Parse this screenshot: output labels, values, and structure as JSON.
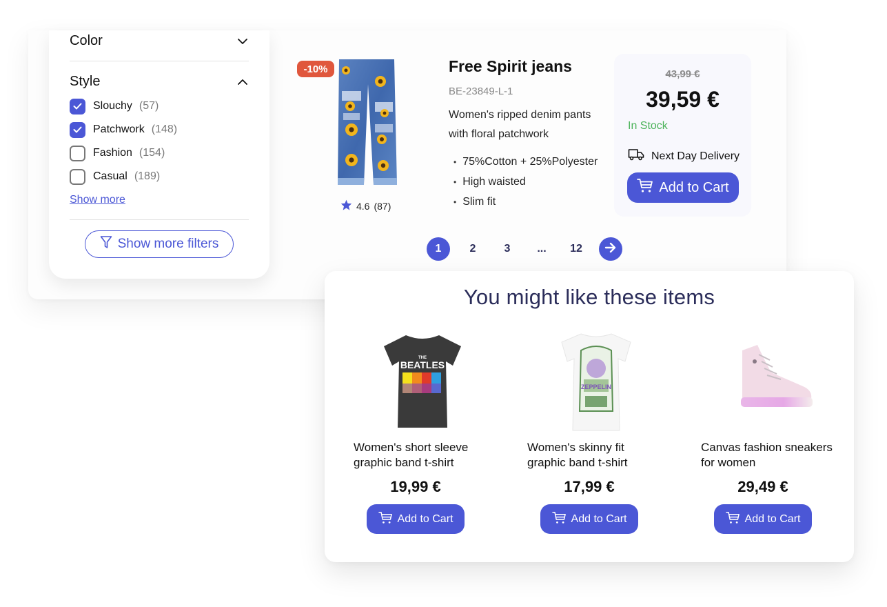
{
  "filters": {
    "color": {
      "label": "Color",
      "expanded": false
    },
    "style": {
      "label": "Style",
      "expanded": true,
      "options": [
        {
          "label": "Slouchy",
          "count": "(57)",
          "checked": true
        },
        {
          "label": "Patchwork",
          "count": "(148)",
          "checked": true
        },
        {
          "label": "Fashion",
          "count": "(154)",
          "checked": false
        },
        {
          "label": "Casual",
          "count": "(189)",
          "checked": false
        }
      ],
      "show_more": "Show more"
    },
    "more_filters_label": "Show more filters"
  },
  "product": {
    "badge": "-10%",
    "image": "jeans-with-sunflower-patches",
    "rating": "4.6",
    "reviews": "(87)",
    "title": "Free Spirit jeans",
    "sku": "BE-23849-L-1",
    "description": "Women's ripped denim pants with floral patchwork",
    "features": [
      "75%Cotton + 25%Polyester",
      "High waisted",
      "Slim fit"
    ],
    "old_price": "43,99 €",
    "price": "39,59 €",
    "stock": "In Stock",
    "delivery": "Next Day Delivery",
    "cart_label": "Add to Cart"
  },
  "pagination": {
    "pages": [
      "1",
      "2",
      "3",
      "...",
      "12"
    ],
    "current": "1",
    "next_icon": "arrow-right-icon"
  },
  "recommendations": {
    "title": "You might like these items",
    "items": [
      {
        "name": "Women's short sleeve graphic band t-shirt",
        "price": "19,99 €",
        "image": "black-beatles-tshirt",
        "cart_label": "Add to Cart"
      },
      {
        "name": "Women's skinny fit graphic band t-shirt",
        "price": "17,99 €",
        "image": "white-led-zeppelin-tshirt",
        "cart_label": "Add to Cart"
      },
      {
        "name": "Canvas fashion sneakers for women",
        "price": "29,49 €",
        "image": "pink-high-top-sneaker",
        "cart_label": "Add to Cart"
      }
    ]
  },
  "colors": {
    "accent": "#4b57d6",
    "badge": "#e0573d",
    "stock": "#4cb35a",
    "heading": "#2b2d5a"
  }
}
